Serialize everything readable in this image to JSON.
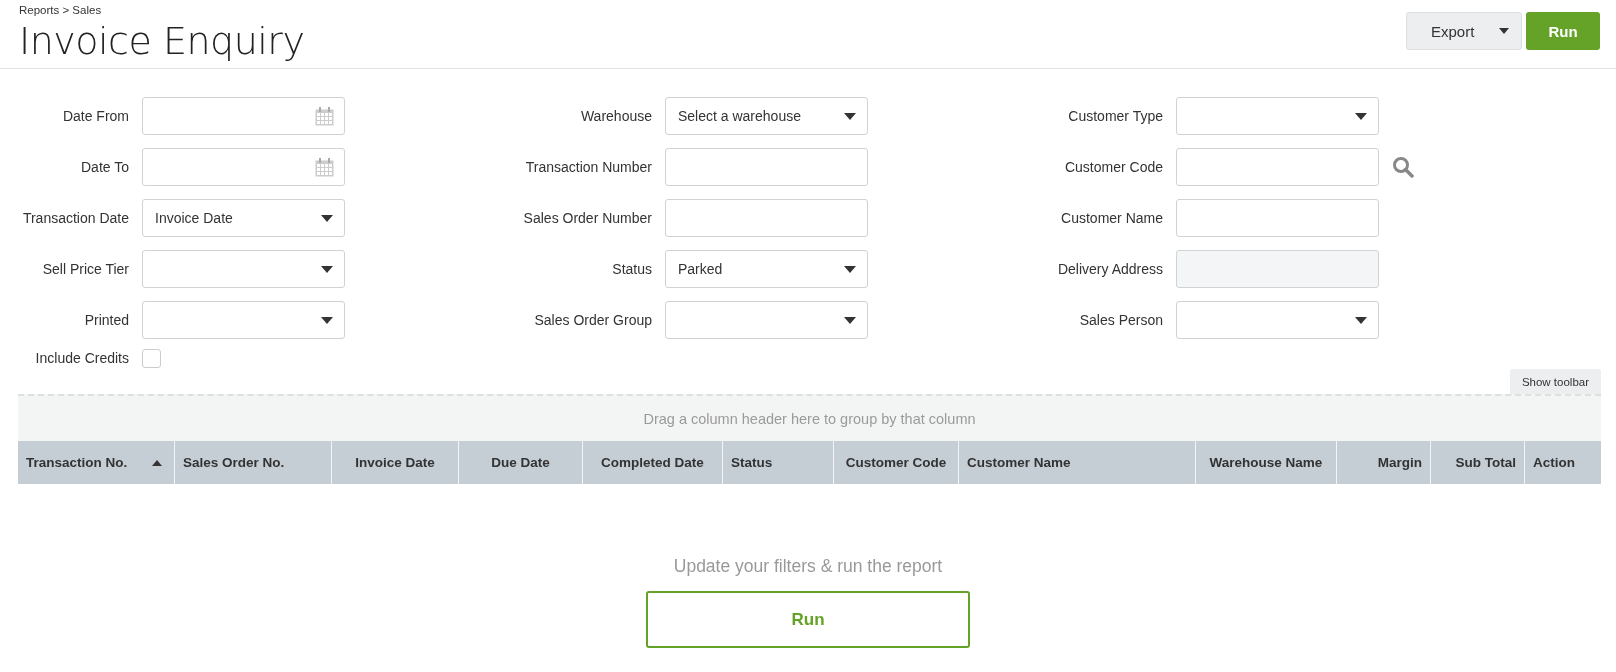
{
  "breadcrumb": "Reports > Sales",
  "title": "Invoice Enquiry",
  "header_buttons": [
    {
      "kind": "split",
      "label": "Export"
    },
    {
      "kind": "primary",
      "label": "Run"
    }
  ],
  "filter_columns": [
    [
      {
        "label": "Date From",
        "kind": "date"
      },
      {
        "label": "Date To",
        "kind": "date"
      },
      {
        "label": "Transaction Date",
        "kind": "select",
        "value": "Invoice Date"
      },
      {
        "label": "Sell Price Tier",
        "kind": "select"
      },
      {
        "label": "Printed",
        "kind": "select"
      },
      {
        "label": "Include Credits",
        "kind": "checkbox",
        "checked": false
      }
    ],
    [
      {
        "label": "Warehouse",
        "kind": "select",
        "value": "Select a warehouse"
      },
      {
        "label": "Transaction Number",
        "kind": "text"
      },
      {
        "label": "Sales Order Number",
        "kind": "text"
      },
      {
        "label": "Status",
        "kind": "select",
        "value": "Parked"
      },
      {
        "label": "Sales Order Group",
        "kind": "select"
      }
    ],
    [
      {
        "label": "Customer Type",
        "kind": "select"
      },
      {
        "label": "Customer Code",
        "kind": "lookup"
      },
      {
        "label": "Customer Name",
        "kind": "text"
      },
      {
        "label": "Delivery Address",
        "kind": "text",
        "disabled": true
      },
      {
        "label": "Sales Person",
        "kind": "select"
      }
    ]
  ],
  "grid": {
    "toolbar_button": "Show toolbar",
    "group_hint": "Drag a column header here to group by that column",
    "columns": [
      {
        "label": "Transaction No.",
        "sorted": true
      },
      {
        "label": "Sales Order No.",
        "sorted": false
      },
      {
        "label": "Invoice Date",
        "sorted": false
      },
      {
        "label": "Due Date",
        "sorted": false
      },
      {
        "label": "Completed Date",
        "sorted": false
      },
      {
        "label": "Status",
        "sorted": false
      },
      {
        "label": "Customer Code",
        "sorted": false
      },
      {
        "label": "Customer Name",
        "sorted": false
      },
      {
        "label": "Warehouse Name",
        "sorted": false
      },
      {
        "label": "Margin",
        "sorted": false
      },
      {
        "label": "Sub Total",
        "sorted": false
      },
      {
        "label": "Action",
        "sorted": false
      }
    ]
  },
  "empty_state": {
    "message": "Update your filters & run the report",
    "button": "Run"
  }
}
